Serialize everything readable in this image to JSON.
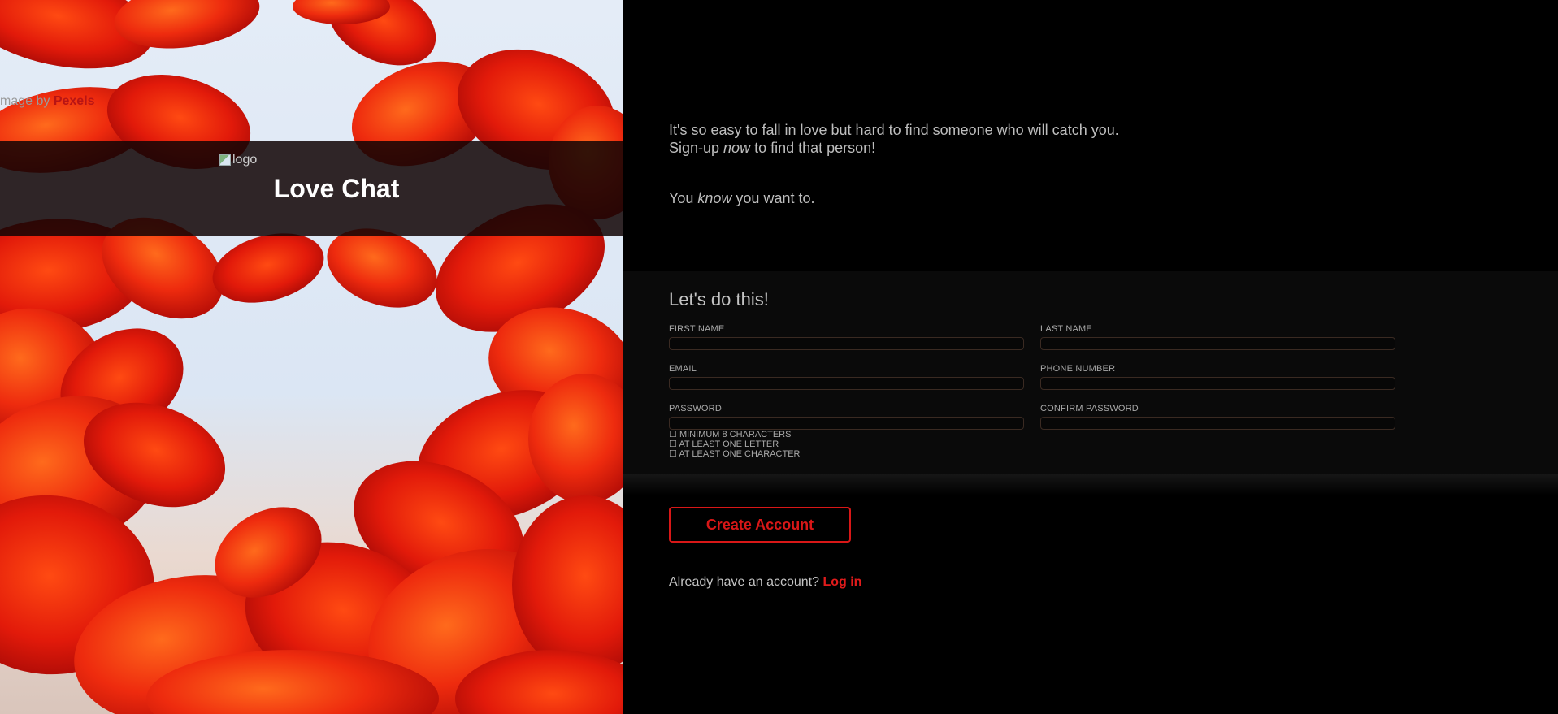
{
  "hero": {
    "credit_prefix": "mage by",
    "credit_link": "Pexels",
    "logo_alt": "logo",
    "brand_title": "Love Chat",
    "accent_color": "#d81717"
  },
  "intro": {
    "line1": "It's so easy to fall in love but hard to find someone who will catch you.",
    "line2_before": "Sign-up ",
    "line2_em": "now",
    "line2_after": " to find that person!",
    "line3_before": "You ",
    "line3_em": "know",
    "line3_after": " you want to."
  },
  "form": {
    "heading": "Let's do this!",
    "fields": {
      "first_name": {
        "label": "FIRST NAME",
        "value": ""
      },
      "last_name": {
        "label": "LAST NAME",
        "value": ""
      },
      "email": {
        "label": "EMAIL",
        "value": ""
      },
      "phone": {
        "label": "PHONE NUMBER",
        "value": ""
      },
      "password": {
        "label": "PASSWORD",
        "value": ""
      },
      "confirm_password": {
        "label": "CONFIRM PASSWORD",
        "value": ""
      }
    },
    "password_rules": [
      {
        "icon": "☐",
        "text": "MINIMUM 8 CHARACTERS"
      },
      {
        "icon": "☐",
        "text": "AT LEAST ONE LETTER"
      },
      {
        "icon": "☐",
        "text": "AT LEAST ONE CHARACTER"
      }
    ],
    "submit_label": "Create Account"
  },
  "login": {
    "prompt": "Already have an account?",
    "link": "Log in"
  }
}
